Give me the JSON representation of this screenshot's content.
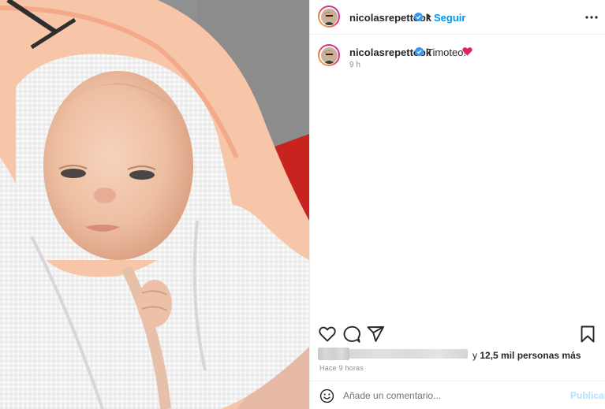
{
  "post": {
    "image_alt": "Newborn baby wrapped in a white and peach hooded towel",
    "author": {
      "username": "nicolasrepettook",
      "verified": true,
      "follow_label": "Seguir",
      "separator": "•"
    },
    "caption": {
      "username": "nicolasrepettook",
      "text": "Timoteo!",
      "emoji": "red-heart",
      "time": "9 h"
    },
    "likes": {
      "text_prefix": "y ",
      "count_text": "12,5 mil personas más"
    },
    "posted_ago": "Hace 9 horas",
    "comment": {
      "placeholder": "Añade un comentario...",
      "value": "",
      "publish_label": "Publicar"
    }
  },
  "icons": {
    "more": "more-horizontal-icon",
    "like": "heart-outline-icon",
    "comment": "comment-bubble-icon",
    "share": "paper-plane-icon",
    "save": "bookmark-icon",
    "emoji": "smiley-icon"
  },
  "colors": {
    "follow_blue": "#0095f6",
    "publish_disabled": "#b2dffc",
    "verified_blue": "#3897f0",
    "muted": "#8e8e8e",
    "text": "#262626",
    "heart_red": "#e0245e"
  }
}
